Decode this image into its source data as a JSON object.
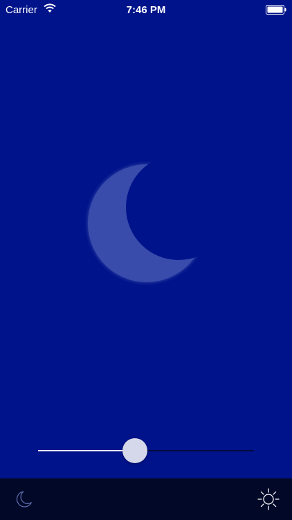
{
  "status_bar": {
    "carrier": "Carrier",
    "time": "7:46 PM",
    "wifi_icon": "wifi-icon",
    "battery_icon": "battery-icon"
  },
  "main": {
    "moon_icon": "moon-icon"
  },
  "brightness_slider": {
    "value": 0.45
  },
  "toolbar": {
    "night_icon": "moon-outline-icon",
    "day_icon": "sun-outline-icon"
  },
  "colors": {
    "background": "#00138a",
    "toolbar": "#010828",
    "thumb": "#d5d8ea"
  }
}
